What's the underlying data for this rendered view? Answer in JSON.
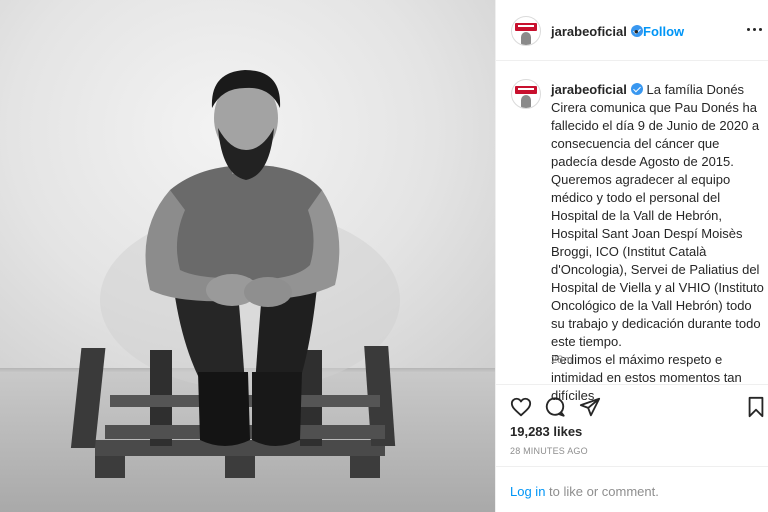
{
  "post": {
    "username": "jarabeoficial",
    "follow_label": "Follow",
    "separator": "•",
    "caption_lines": [
      "La família Donés Cirera comunica que Pau Donés ha fallecido el día 9 de Junio de 2020 a consecuencia del cáncer que padecía desde Agosto de 2015.",
      "Queremos agradecer al equipo médico y todo el personal del Hospital de la Vall de Hebrón, Hospital Sant Joan Despí Moisès Broggi, ICO (Institut Català d'Oncologia), Servei de Paliatius del Hospital de Viella y al VHIO (Instituto Oncológico de la Vall Hebrón) todo su trabajo y dedicación durante todo este tiempo.",
      "Pedimos el máximo respeto e intimidad en estos momentos tan difíciles"
    ],
    "caption_time": "28m",
    "likes": "19,283 likes",
    "posted_ago": "28 MINUTES AGO",
    "login_link": "Log in",
    "login_suffix": " to like or comment."
  },
  "icons": {
    "avatar": "avatar-logo",
    "verified": "verified-badge-icon",
    "more": "more-options-icon",
    "like": "heart-icon",
    "comment": "comment-bubble-icon",
    "share": "paper-plane-icon",
    "save": "bookmark-icon"
  },
  "colors": {
    "link_blue": "#0095f6",
    "verified_blue": "#3897f0",
    "muted": "#8e8e8e",
    "text": "#262626"
  }
}
